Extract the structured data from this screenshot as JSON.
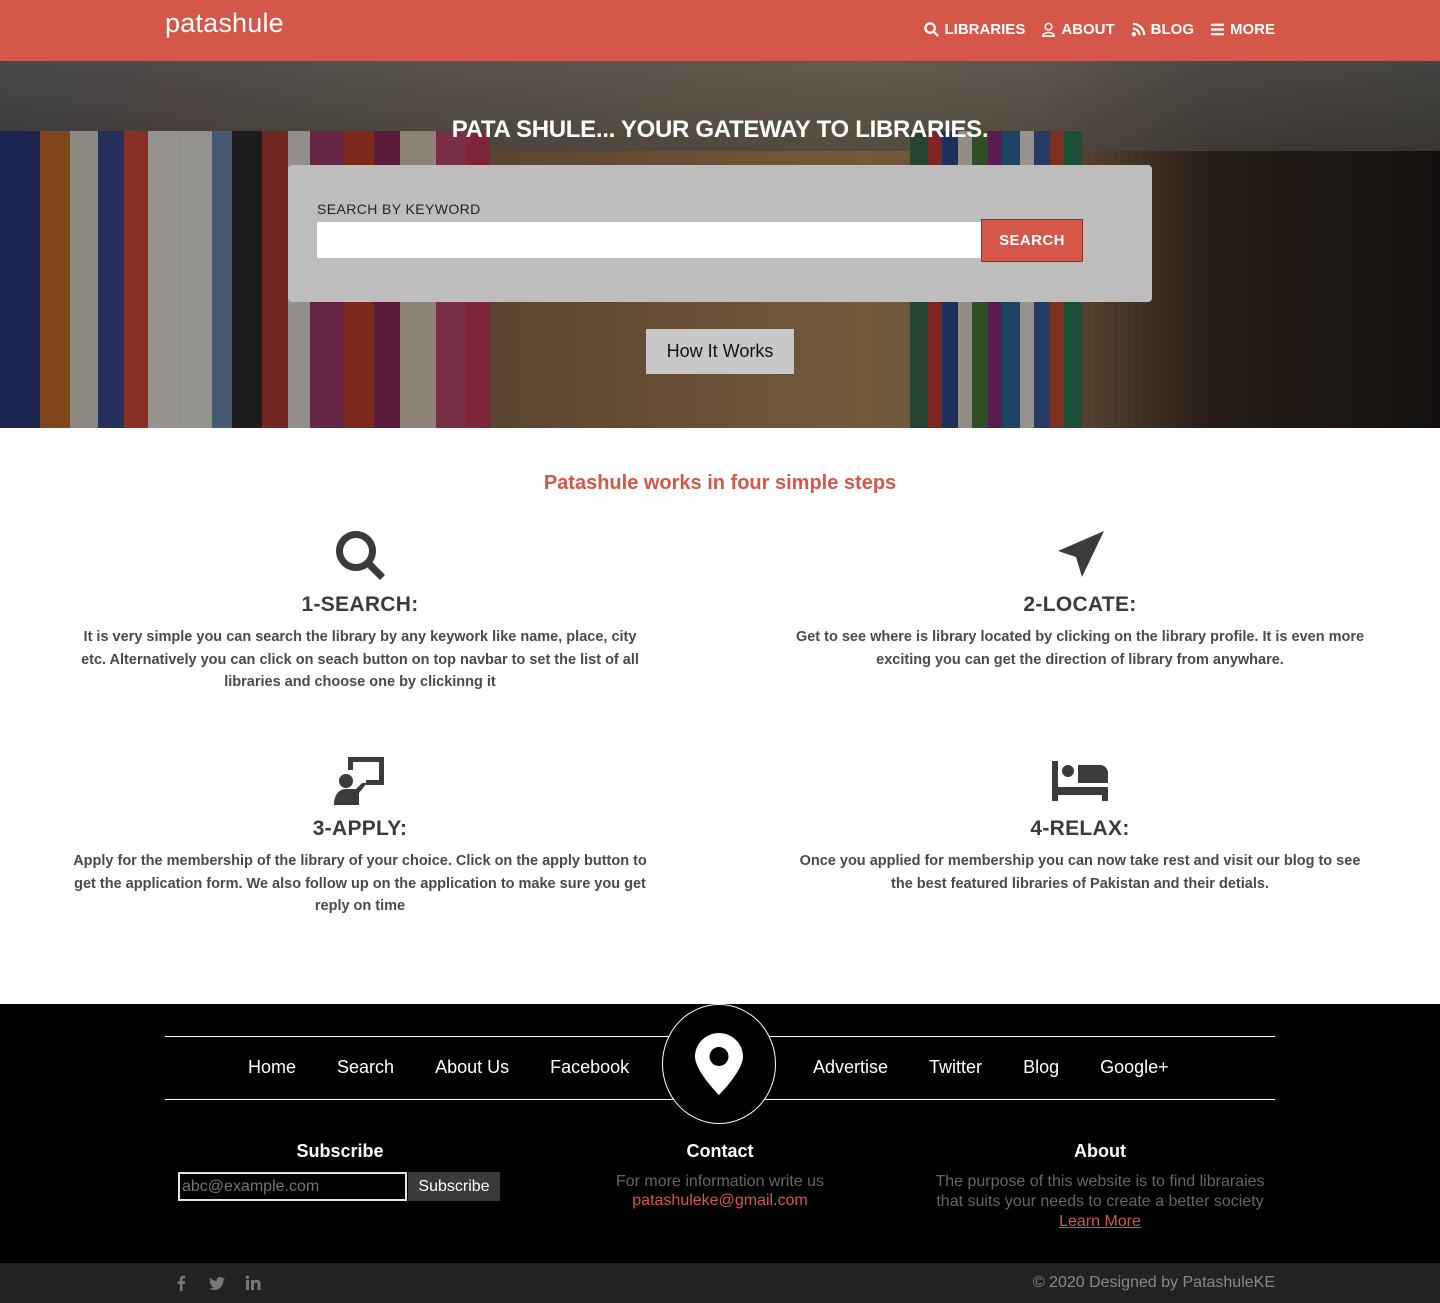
{
  "navbar": {
    "brand": "patashule",
    "links": [
      {
        "label": "LIBRARIES",
        "icon": "search-icon"
      },
      {
        "label": "ABOUT",
        "icon": "user-icon"
      },
      {
        "label": "BLOG",
        "icon": "rss-icon"
      },
      {
        "label": "MORE",
        "icon": "menu-icon"
      }
    ]
  },
  "hero": {
    "title": "PATA SHULE... YOUR GATEWAY TO LIBRARIES.",
    "search_label": "SEARCH BY KEYWORD",
    "search_value": "",
    "search_button": "SEARCH",
    "how_button": "How It Works"
  },
  "steps": {
    "title": "Patashule works in four simple steps",
    "items": [
      {
        "icon": "search-icon",
        "heading": "1-SEARCH:",
        "text": "It is very simple you can search the library by any keywork like name, place, city etc. Alternatively you can click on seach button on top navbar to set the list of all libraries and choose one by clickinng it"
      },
      {
        "icon": "location-arrow-icon",
        "heading": "2-LOCATE:",
        "text": "Get to see where is library located by clicking on the library profile. It is even more exciting you can get the direction of library from anywhare."
      },
      {
        "icon": "presentation-icon",
        "heading": "3-APPLY:",
        "text": "Apply for the membership of the library of your choice. Click on the apply button to get the application form. We also follow up on the application to make sure you get reply on time"
      },
      {
        "icon": "bed-icon",
        "heading": "4-RELAX:",
        "text": "Once you applied for membership you can now take rest and visit our blog to see the best featured libraries of Pakistan and their detials."
      }
    ]
  },
  "footer": {
    "links_left": [
      "Home",
      "Search",
      "About Us",
      "Facebook"
    ],
    "links_right": [
      "Advertise",
      "Twitter",
      "Blog",
      "Google+"
    ],
    "subscribe": {
      "title": "Subscribe",
      "placeholder": "abc@example.com",
      "button": "Subscribe"
    },
    "contact": {
      "title": "Contact",
      "text": "For more information write us",
      "email": "patashuleke@gmail.com"
    },
    "about": {
      "title": "About",
      "text": "The purpose of this website is to find libraraies that suits your needs to create a better society",
      "link": "Learn More"
    },
    "copyright": "© 2020 Designed by PatashuleKE",
    "social": [
      "facebook-icon",
      "twitter-icon",
      "linkedin-icon"
    ]
  },
  "colors": {
    "accent": "#d4574a",
    "dark": "#3b3b3b"
  }
}
